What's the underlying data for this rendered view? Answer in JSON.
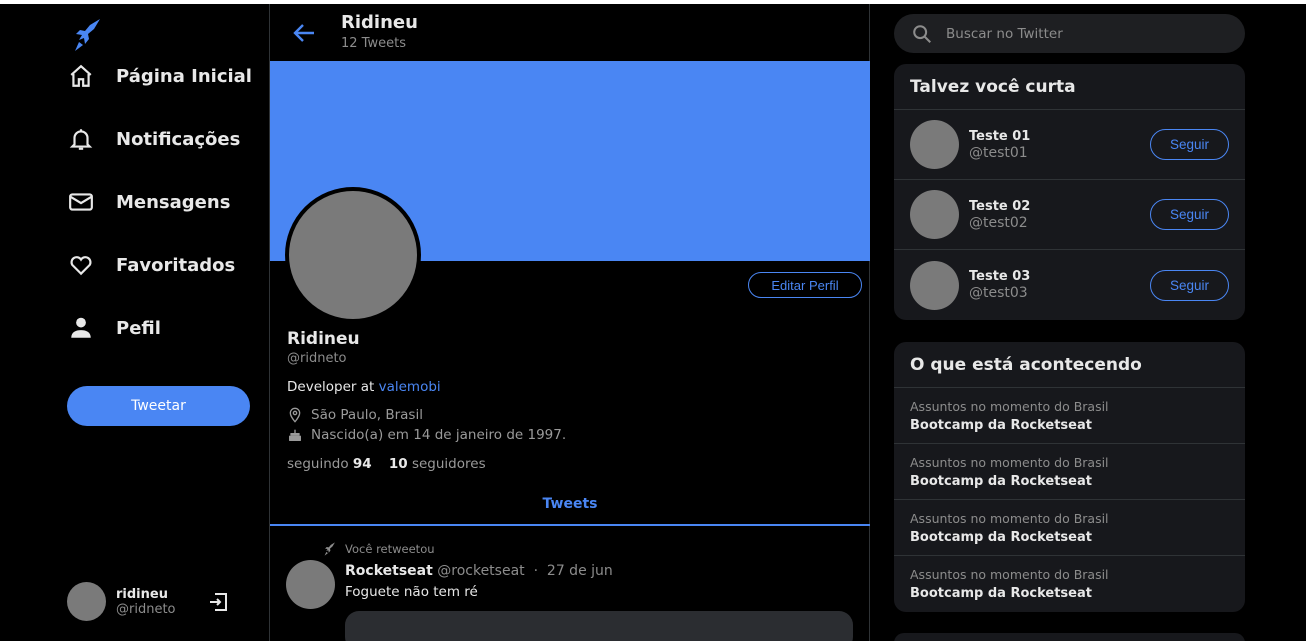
{
  "nav": {
    "items": [
      {
        "label": "Página Inicial",
        "icon": "home-icon"
      },
      {
        "label": "Notificações",
        "icon": "bell-icon"
      },
      {
        "label": "Mensagens",
        "icon": "mail-icon"
      },
      {
        "label": "Favoritados",
        "icon": "heart-icon"
      },
      {
        "label": "Pefil",
        "icon": "person-icon"
      }
    ],
    "tweet_button": "Tweetar"
  },
  "current_user": {
    "name": "ridineu",
    "handle": "@ridneto"
  },
  "header": {
    "title": "Ridineu",
    "subtitle": "12 Tweets"
  },
  "profile": {
    "name": "Ridineu",
    "handle": "@ridneto",
    "bio_prefix": "Developer at",
    "bio_link": "valemobi",
    "location": "São Paulo, Brasil",
    "birthday": "Nascido(a) em 14 de janeiro de 1997.",
    "following_label": "seguindo",
    "following_count": "94",
    "followers_count": "10",
    "followers_label": "seguidores",
    "edit_button": "Editar Perfil"
  },
  "tabs": {
    "active": "Tweets"
  },
  "tweet": {
    "retweet_note": "Você retweetou",
    "author": "Rocketseat",
    "handle": "@rocketseat",
    "separator": "·",
    "date": "27 de jun",
    "text": "Foguete não tem ré"
  },
  "search": {
    "placeholder": "Buscar no Twitter"
  },
  "suggestions": {
    "title": "Talvez você curta",
    "follow_label": "Seguir",
    "items": [
      {
        "name": "Teste 01",
        "handle": "@test01"
      },
      {
        "name": "Teste 02",
        "handle": "@test02"
      },
      {
        "name": "Teste 03",
        "handle": "@test03"
      }
    ]
  },
  "trends": {
    "title": "O que está acontecendo",
    "items": [
      {
        "context": "Assuntos no momento do Brasil",
        "topic": "Bootcamp da Rocketseat"
      },
      {
        "context": "Assuntos no momento do Brasil",
        "topic": "Bootcamp da Rocketseat"
      },
      {
        "context": "Assuntos no momento do Brasil",
        "topic": "Bootcamp da Rocketseat"
      },
      {
        "context": "Assuntos no momento do Brasil",
        "topic": "Bootcamp da Rocketseat"
      }
    ]
  },
  "colors": {
    "accent": "#4a86f3",
    "background": "#000000",
    "card": "#17181c",
    "muted": "#8c8c8c"
  }
}
